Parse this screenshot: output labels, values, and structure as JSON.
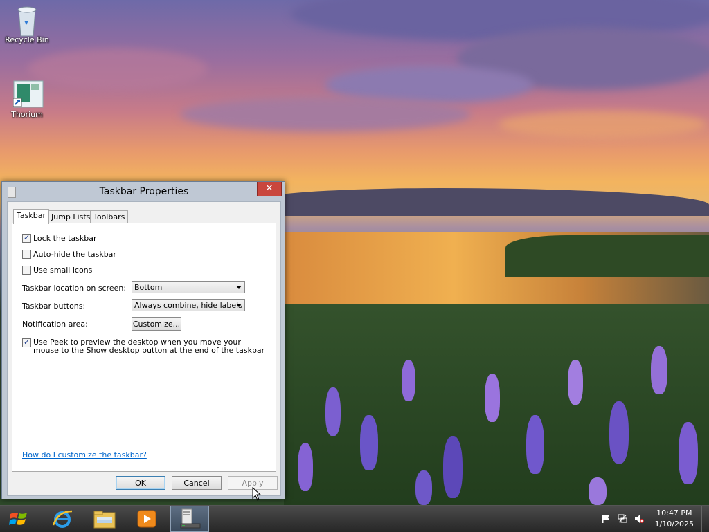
{
  "desktop": {
    "icons": [
      {
        "label": "Recycle Bin"
      },
      {
        "label": "Thorium"
      }
    ]
  },
  "window": {
    "title": "Taskbar Properties",
    "close_label": "✕",
    "tabs": [
      {
        "label": "Taskbar",
        "active": true
      },
      {
        "label": "Jump Lists",
        "active": false
      },
      {
        "label": "Toolbars",
        "active": false
      }
    ],
    "options": {
      "lock_taskbar": {
        "label": "Lock the taskbar",
        "checked": true
      },
      "auto_hide": {
        "label": "Auto-hide the taskbar",
        "checked": false
      },
      "small_icons": {
        "label": "Use small icons",
        "checked": false
      },
      "peek": {
        "label": "Use Peek to preview the desktop when you move your mouse to the Show desktop button at the end of the taskbar",
        "checked": true
      }
    },
    "location": {
      "label": "Taskbar location on screen:",
      "value": "Bottom"
    },
    "buttons": {
      "label": "Taskbar buttons:",
      "value": "Always combine, hide labels"
    },
    "notification": {
      "label": "Notification area:",
      "button": "Customize..."
    },
    "help_link": "How do I customize the taskbar?",
    "footer": {
      "ok": "OK",
      "cancel": "Cancel",
      "apply": "Apply"
    }
  },
  "taskbar": {
    "pinned": [
      {
        "icon": "start-orb-icon"
      },
      {
        "icon": "internet-explorer-icon"
      },
      {
        "icon": "file-explorer-icon"
      },
      {
        "icon": "media-player-icon"
      },
      {
        "icon": "taskbar-properties-icon",
        "active": true
      }
    ],
    "tray": {
      "icons": [
        "action-center-flag-icon",
        "network-icon",
        "volume-muted-icon"
      ]
    },
    "clock": {
      "time": "10:47 PM",
      "date": "1/10/2025"
    }
  },
  "colors": {
    "close_red": "#c9463d",
    "link_blue": "#0066cc",
    "window_frame": "#bfc8d4"
  }
}
